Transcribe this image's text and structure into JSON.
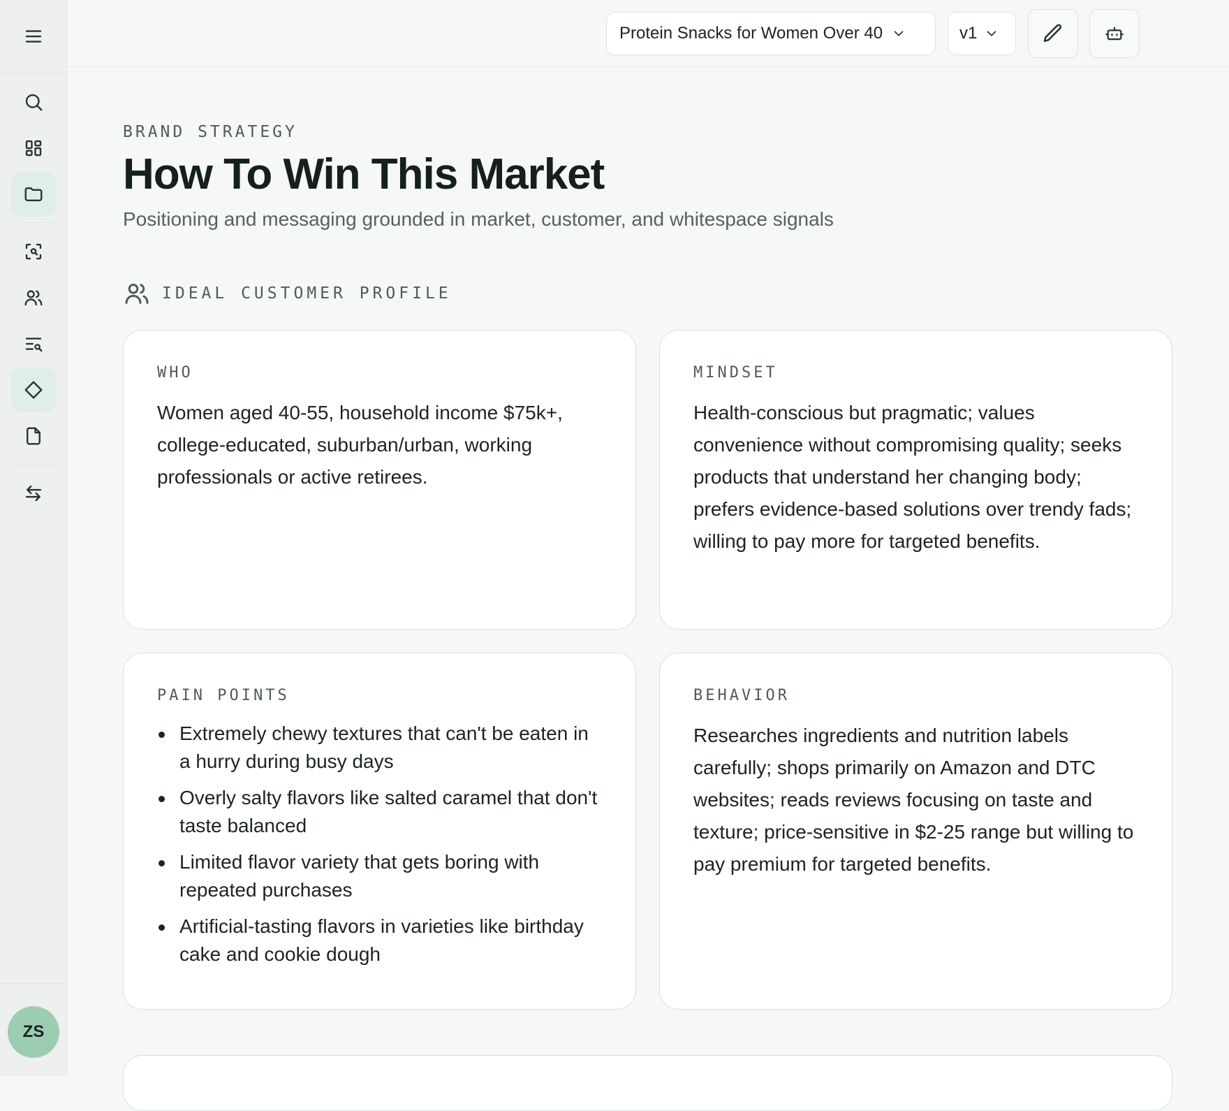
{
  "header": {
    "project": "Protein Snacks for Women Over 40",
    "version": "v1"
  },
  "sidebar": {
    "avatar_initials": "ZS"
  },
  "page": {
    "eyebrow": "BRAND STRATEGY",
    "title": "How To Win This Market",
    "subtitle": "Positioning and messaging grounded in market, customer, and whitespace signals"
  },
  "icp": {
    "section_label": "IDEAL CUSTOMER PROFILE",
    "who": {
      "label": "WHO",
      "text": "Women aged 40-55, household income $75k+, college-educated, suburban/urban, working professionals or active retirees."
    },
    "mindset": {
      "label": "MINDSET",
      "text": "Health-conscious but pragmatic; values convenience without compromising quality; seeks products that understand her changing body; prefers evidence-based solutions over trendy fads; willing to pay more for targeted benefits."
    },
    "pain_points": {
      "label": "PAIN POINTS",
      "items": [
        "Extremely chewy textures that can't be eaten in a hurry during busy days",
        "Overly salty flavors like salted caramel that don't taste balanced",
        "Limited flavor variety that gets boring with repeated purchases",
        "Artificial-tasting flavors in varieties like birthday cake and cookie dough"
      ]
    },
    "behavior": {
      "label": "BEHAVIOR",
      "text": "Researches ingredients and nutrition labels carefully; shops primarily on Amazon and DTC websites; reads reviews focusing on taste and texture; price-sensitive in $2-25 range but willing to pay premium for targeted benefits."
    }
  }
}
